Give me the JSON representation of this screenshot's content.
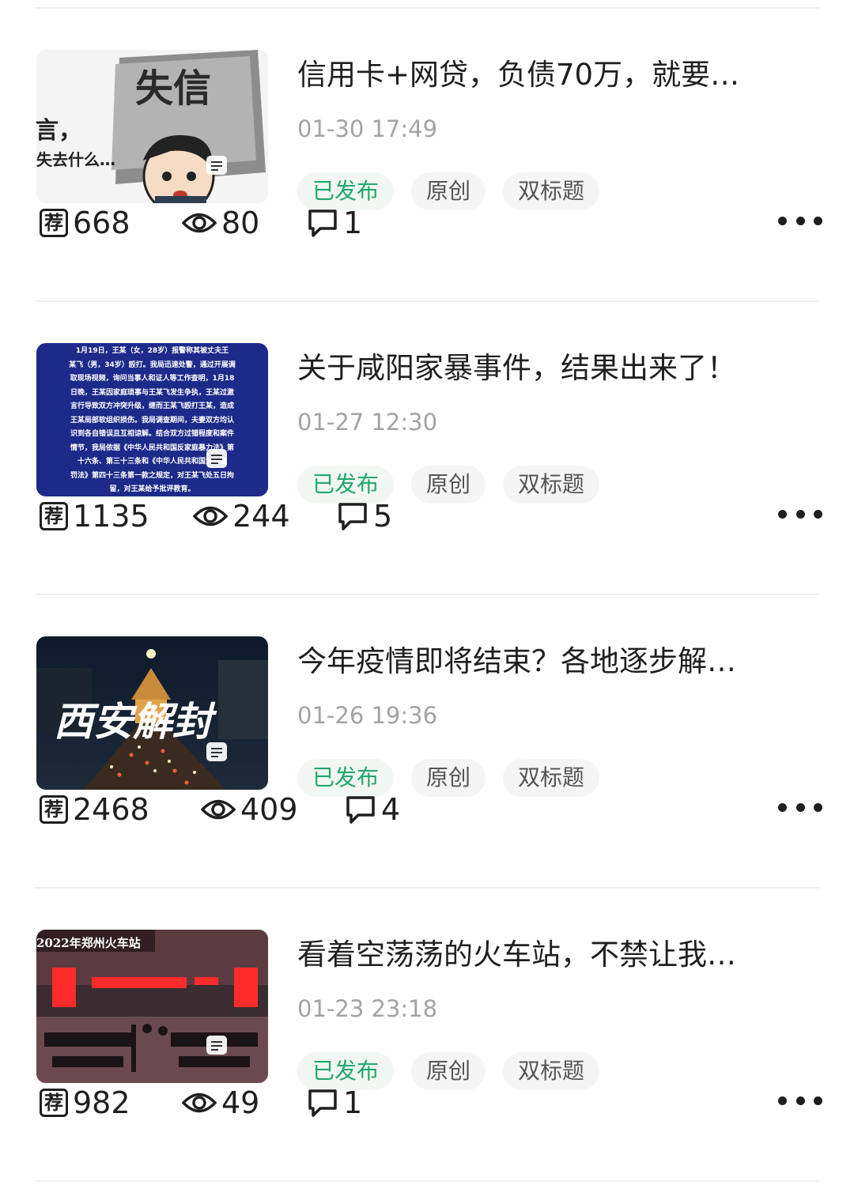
{
  "articles": [
    {
      "title": "信用卡+网贷，负债70万，就要…",
      "time": "01-30 17:49",
      "tags": {
        "published": "已发布",
        "original": "原创",
        "double_title": "双标题"
      },
      "stats": {
        "recommend_icon": "荐",
        "recommend": "668",
        "views": "80",
        "comments": "1"
      },
      "thumb": {
        "kind": "cartoon",
        "text_big": "失信",
        "text_side1": "言，",
        "text_side2": "失去什么…"
      }
    },
    {
      "title": "关于咸阳家暴事件，结果出来了！",
      "time": "01-27 12:30",
      "tags": {
        "published": "已发布",
        "original": "原创",
        "double_title": "双标题"
      },
      "stats": {
        "recommend_icon": "荐",
        "recommend": "1135",
        "views": "244",
        "comments": "5"
      },
      "thumb": {
        "kind": "notice",
        "lines": [
          "1月19日，王某（女，28岁）报警称其被丈夫王",
          "某飞（男，34岁）殴打。我局迅速处警，通过开展调",
          "取现场视频，询问当事人和证人等工作查明，1月18",
          "日晚，王某因家庭琐事与王某飞发生争执，王某过激",
          "言行导致双方冲突升级，继而王某飞殴打王某，造成",
          "王某局部软组织损伤。我局调查期间，夫妻双方均认",
          "识到各自错误且互相谅解。结合双方过错程度和案件",
          "情节，我局依据《中华人民共和国反家庭暴力法》第",
          "十六条、第三十三条和《中华人民共和国治安管",
          "罚法》第四十三条第一款之规定，对王某飞处五日拘",
          "留，对王某给予批评教育。"
        ]
      }
    },
    {
      "title": "今年疫情即将结束？各地逐步解…",
      "time": "01-26 19:36",
      "tags": {
        "published": "已发布",
        "original": "原创",
        "double_title": "双标题"
      },
      "stats": {
        "recommend_icon": "荐",
        "recommend": "2468",
        "views": "409",
        "comments": "4"
      },
      "thumb": {
        "kind": "city",
        "caption": "西安解封"
      }
    },
    {
      "title": "看着空荡荡的火车站，不禁让我…",
      "time": "01-23 23:18",
      "tags": {
        "published": "已发布",
        "original": "原创",
        "double_title": "双标题"
      },
      "stats": {
        "recommend_icon": "荐",
        "recommend": "982",
        "views": "49",
        "comments": "1"
      },
      "thumb": {
        "kind": "station",
        "caption": "2022年郑州火车站"
      }
    }
  ],
  "icons": {
    "recommend": "recommend-icon",
    "views": "eye-icon",
    "comments": "comment-icon",
    "more": "more-dots-icon",
    "doc_badge": "document-icon"
  },
  "colors": {
    "published": "#20a86a",
    "muted": "#a3a3a3",
    "tag_bg": "#f5f5f5",
    "notice_bg": "#1e2a8a"
  }
}
